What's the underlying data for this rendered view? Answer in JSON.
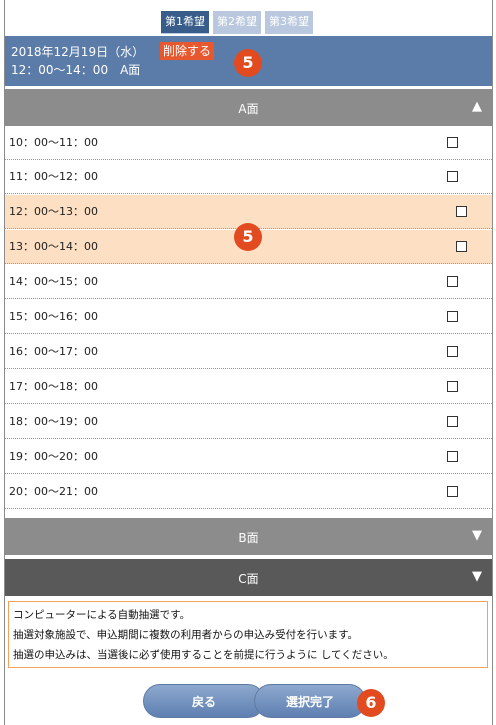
{
  "tabs": [
    {
      "label": "第1希望"
    },
    {
      "label": "第2希望"
    },
    {
      "label": "第3希望"
    }
  ],
  "selection": {
    "date": "2018年12月19日（水）",
    "delete_label": "削除する",
    "time": "12：00～14：00　A面"
  },
  "badges": {
    "b1": "5",
    "b2": "5",
    "b3": "6"
  },
  "sections": {
    "a": {
      "title": "A面",
      "arrow": "▲"
    },
    "b": {
      "title": "B面",
      "arrow": "▼"
    },
    "c": {
      "title": "C面",
      "arrow": "▼"
    }
  },
  "slots": [
    {
      "label": "10：00～11：00"
    },
    {
      "label": "11：00～12：00"
    },
    {
      "label": "12：00～13：00"
    },
    {
      "label": "13：00～14：00"
    },
    {
      "label": "14：00～15：00"
    },
    {
      "label": "15：00～16：00"
    },
    {
      "label": "16：00～17：00"
    },
    {
      "label": "17：00～18：00"
    },
    {
      "label": "18：00～19：00"
    },
    {
      "label": "19：00～20：00"
    },
    {
      "label": "20：00～21：00"
    }
  ],
  "notice": {
    "line1": "コンピューターによる自動抽選です。",
    "line2": "抽選対象施設で、申込期間に複数の利用者からの申込み受付を行います。",
    "line3": "抽選の申込みは、当選後に必ず使用することを前提に行うように してください。"
  },
  "buttons": {
    "back": "戻る",
    "done": "選択完了"
  },
  "colors": {
    "active_tab": "#385d8a",
    "inactive_tab": "#b9c8de",
    "selection_bg": "#5b7ca9",
    "delete_button": "#e8582e",
    "section_header": "#8c8c8c",
    "section_header_dark": "#595959",
    "highlight_row": "#fde0c3",
    "badge": "#e24b1f",
    "notice_border": "#f0a35a",
    "button": "#6f8fbe"
  }
}
